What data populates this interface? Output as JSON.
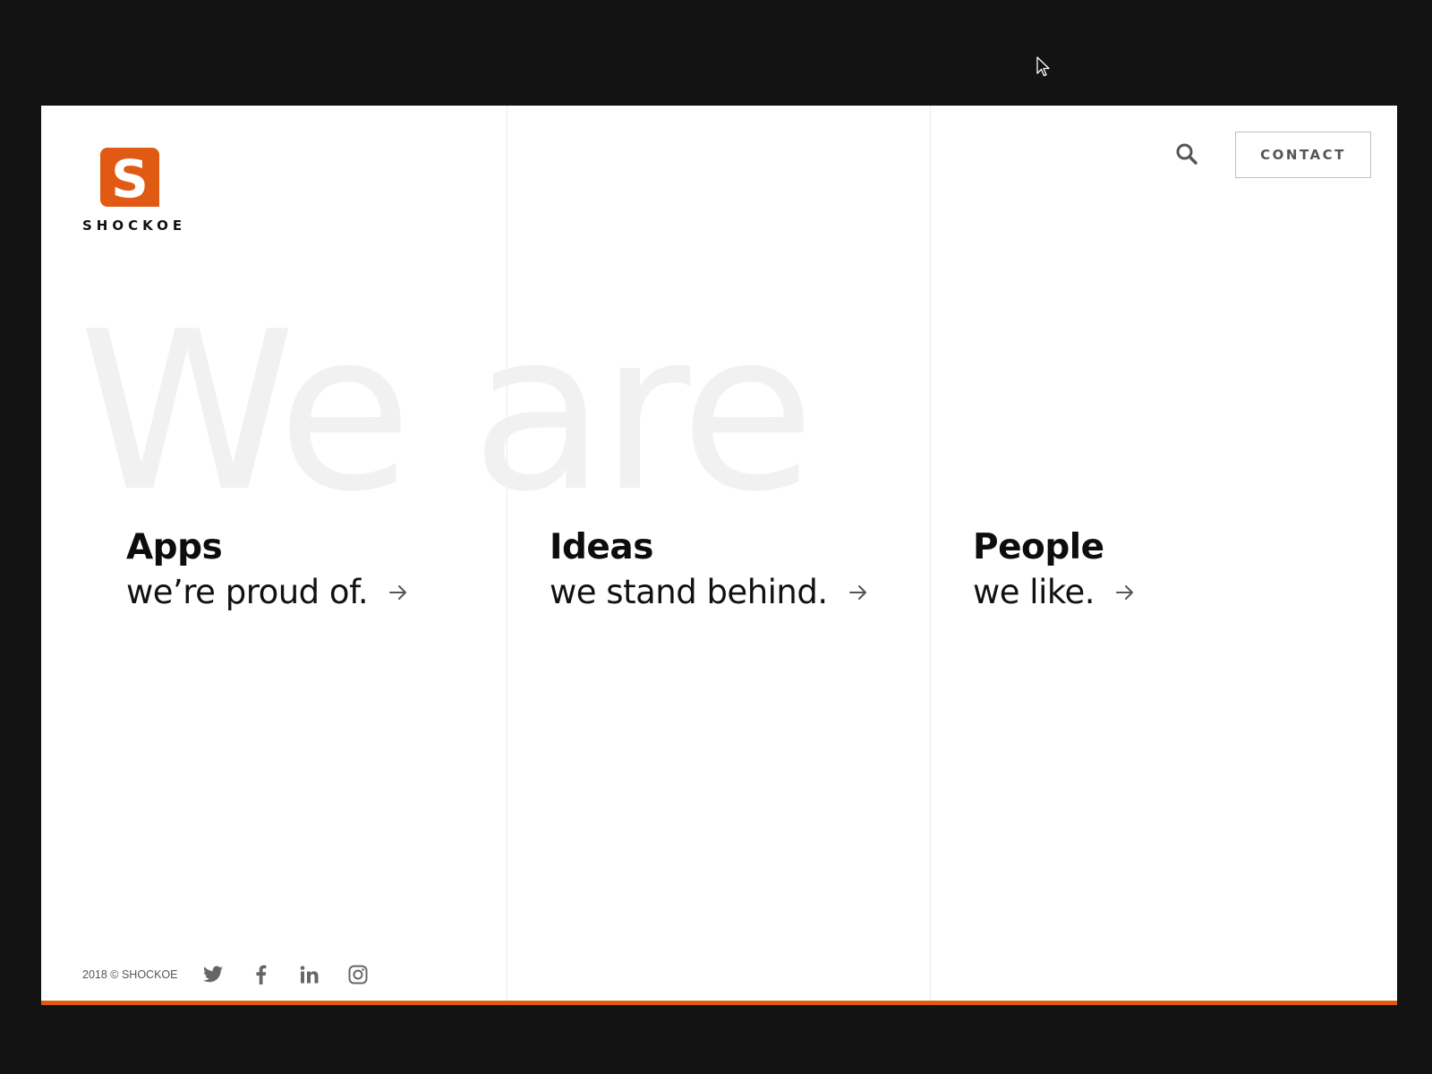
{
  "brand": {
    "name": "SHOCKOE",
    "logo_letter": "S",
    "accent_color": "#e05a14"
  },
  "header": {
    "contact_label": "CONTACT"
  },
  "hero": {
    "background_word": "We are"
  },
  "pillars": [
    {
      "title": "Apps",
      "subtitle": "we’re proud of."
    },
    {
      "title": "Ideas",
      "subtitle": "we stand behind."
    },
    {
      "title": "People",
      "subtitle": "we like."
    }
  ],
  "footer": {
    "copyright": "2018 © SHOCKOE",
    "social_icons": [
      "twitter-icon",
      "facebook-icon",
      "linkedin-icon",
      "instagram-icon"
    ]
  }
}
